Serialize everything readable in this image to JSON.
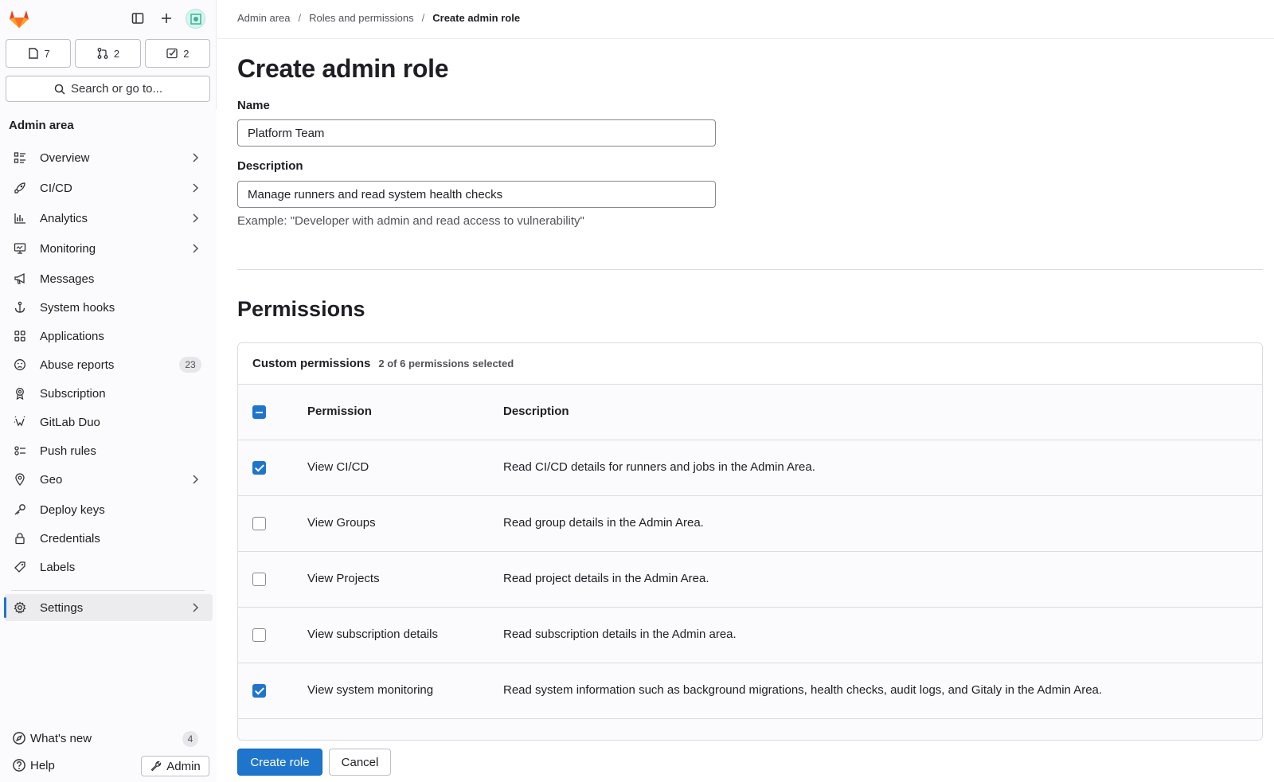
{
  "sidebar": {
    "counters": [
      {
        "icon": "issues-icon",
        "count": "7"
      },
      {
        "icon": "merge-request-icon",
        "count": "2"
      },
      {
        "icon": "todo-icon",
        "count": "2"
      }
    ],
    "search_label": "Search or go to...",
    "section_title": "Admin area",
    "items": [
      {
        "label": "Overview",
        "icon": "overview-icon"
      },
      {
        "label": "CI/CD",
        "icon": "rocket-icon"
      },
      {
        "label": "Analytics",
        "icon": "chart-icon"
      },
      {
        "label": "Monitoring",
        "icon": "monitor-icon"
      },
      {
        "label": "Messages",
        "icon": "megaphone-icon"
      },
      {
        "label": "System hooks",
        "icon": "anchor-icon"
      },
      {
        "label": "Applications",
        "icon": "grid-icon"
      },
      {
        "label": "Abuse reports",
        "icon": "sad-face-icon",
        "badge": "23"
      },
      {
        "label": "Subscription",
        "icon": "license-icon"
      },
      {
        "label": "GitLab Duo",
        "icon": "tanuki-ai-icon"
      },
      {
        "label": "Push rules",
        "icon": "push-rules-icon"
      },
      {
        "label": "Geo",
        "icon": "location-icon"
      },
      {
        "label": "Deploy keys",
        "icon": "key-icon"
      },
      {
        "label": "Credentials",
        "icon": "lock-icon"
      },
      {
        "label": "Labels",
        "icon": "label-icon"
      },
      {
        "label": "Settings",
        "icon": "settings-icon"
      }
    ],
    "whats_new": "What's new",
    "whats_new_count": "4",
    "help": "Help",
    "admin": "Admin"
  },
  "breadcrumb": {
    "item1": "Admin area",
    "item2": "Roles and permissions",
    "item3": "Create admin role"
  },
  "form": {
    "title": "Create admin role",
    "name_label": "Name",
    "name_value": "Platform Team",
    "description_label": "Description",
    "description_value": "Manage runners and read system health checks",
    "description_help": "Example: \"Developer with admin and read access to vulnerability\""
  },
  "permissions": {
    "title": "Permissions",
    "card_title": "Custom permissions",
    "selected_count": "2 of 6 permissions selected",
    "col_permission": "Permission",
    "col_description": "Description",
    "rows": [
      {
        "name": "View CI/CD",
        "description": "Read CI/CD details for runners and jobs in the Admin Area.",
        "checked": true
      },
      {
        "name": "View Groups",
        "description": "Read group details in the Admin Area.",
        "checked": false
      },
      {
        "name": "View Projects",
        "description": "Read project details in the Admin Area.",
        "checked": false
      },
      {
        "name": "View subscription details",
        "description": "Read subscription details in the Admin area.",
        "checked": false
      },
      {
        "name": "View system monitoring",
        "description": "Read system information such as background migrations, health checks, audit logs, and Gitaly in the Admin Area.",
        "checked": true
      }
    ]
  },
  "actions": {
    "create": "Create role",
    "cancel": "Cancel"
  },
  "colors": {
    "primary": "#1f75cb",
    "sidebar_bg": "#fbfafd"
  }
}
